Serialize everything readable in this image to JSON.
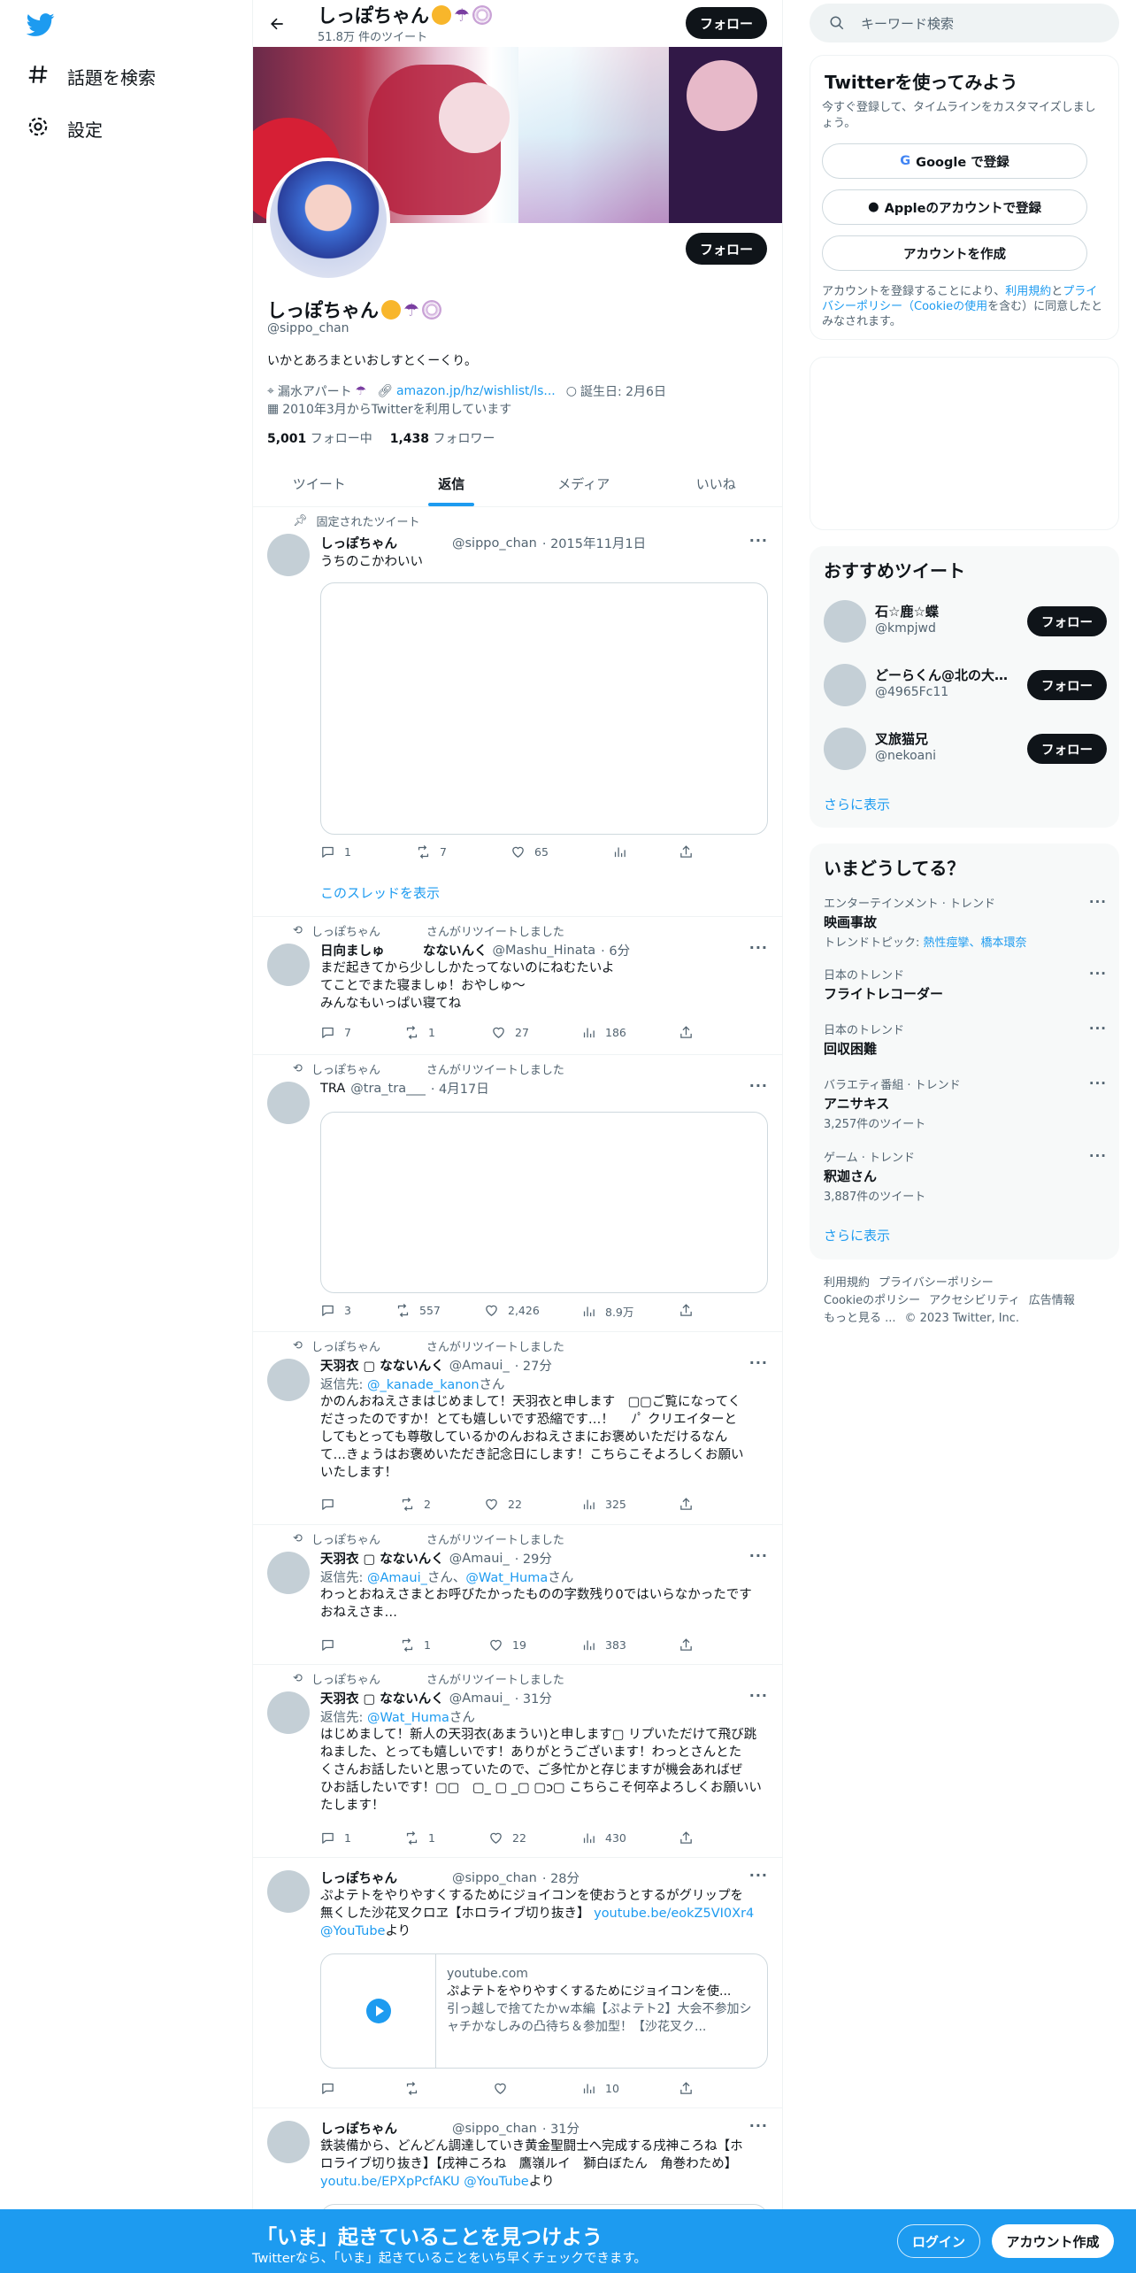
{
  "nav": {
    "explore_label": "話題を検索",
    "settings_label": "設定"
  },
  "header": {
    "name": "しっぽちゃん",
    "tweet_count": "51.8万 件のツイート",
    "follow_label": "フォロー"
  },
  "profile": {
    "name": "しっぽちゃん",
    "handle": "@sippo_chan",
    "bio": "いかとあろまといおしすとくーくり。",
    "location": "漏水アパート",
    "url": "amazon.jp/hz/wishlist/ls...",
    "birthday": "誕生日: 2月6日",
    "joined": "2010年3月からTwitterを利用しています",
    "following_count": "5,001",
    "following_label": "フォロー中",
    "followers_count": "1,438",
    "followers_label": "フォロワー",
    "follow_label": "フォロー"
  },
  "tabs": [
    {
      "label": "ツイート"
    },
    {
      "label": "返信"
    },
    {
      "label": "メディア"
    },
    {
      "label": "いいね"
    }
  ],
  "tweets": [
    {
      "social": "固定されたツイート",
      "name": "しっぽちゃん",
      "handle": "@sippo_chan",
      "time": "· 2015年11月1日",
      "text": "うちのこかわいい",
      "replies": "1",
      "retweets": "7",
      "likes": "65",
      "views": "",
      "thread_link": "このスレッドを表示"
    },
    {
      "social": "しっぽちゃん　　　　さんがリツイートしました",
      "name": "日向ましゅ　　　なないんく",
      "handle": "@Mashu_Hinata",
      "time": "· 6分",
      "text": "まだ起きてから少ししかたってないのにねむたいよ\nてことでまた寝ましゅ！おやしゅ～\nみんなもいっぱい寝てね",
      "replies": "7",
      "retweets": "1",
      "likes": "27",
      "views": "186"
    },
    {
      "social": "しっぽちゃん　　　　さんがリツイートしました",
      "name": "TRA",
      "handle": "@tra_tra___",
      "time": "· 4月17日",
      "text": "",
      "replies": "3",
      "retweets": "557",
      "likes": "2,426",
      "views": "8.9万"
    },
    {
      "social": "しっぽちゃん　　　　さんがリツイートしました",
      "name": "天羽衣 ▢ なないんく",
      "handle": "@Amaui_",
      "time": "· 27分",
      "reply_prefix": "返信先: ",
      "reply_to": "@_kanade_kanon",
      "reply_suffix": "さん",
      "text": "かのんおねえさまはじめまして！天羽衣と申します　▢▢ご覧になってく\nださったのですか！とても嬉しいです恐縮です…！　 ﾉﾟ クリエイターと\nしてもとっても尊敬しているかのんおねえさまにお褒めいただけるなん\nて…きょうはお褒めいただき記念日にします！こちらこそよろしくお願い\nいたします！",
      "replies": "",
      "retweets": "2",
      "likes": "22",
      "views": "325"
    },
    {
      "social": "しっぽちゃん　　　　さんがリツイートしました",
      "name": "天羽衣 ▢ なないんく",
      "handle": "@Amaui_",
      "time": "· 29分",
      "reply_prefix": "返信先: ",
      "reply_to": "@Amaui_",
      "reply_mid": "さん、",
      "reply_to2": "@Wat_Huma",
      "reply_suffix": "さん",
      "text": "わっとおねえさまとお呼びたかったものの字数残り0ではいらなかったです\nおねえさま…",
      "replies": "",
      "retweets": "1",
      "likes": "19",
      "views": "383"
    },
    {
      "social": "しっぽちゃん　　　　さんがリツイートしました",
      "name": "天羽衣 ▢ なないんく",
      "handle": "@Amaui_",
      "time": "· 31分",
      "reply_prefix": "返信先: ",
      "reply_to": "@Wat_Huma",
      "reply_suffix": "さん",
      "text": "はじめまして！新人の天羽衣(あまうい)と申します▢ リプいただけて飛び跳\nねました、とっても嬉しいです！ありがとうございます！わっとさんとた\nくさんお話したいと思っていたので、ご多忙かと存じますが機会あればぜ\nひお話したいです！▢▢　▢_ ▢ _▢ ▢ɔ▢ こちらこそ何卒よろしくお願いい\nたします！",
      "replies": "1",
      "retweets": "1",
      "likes": "22",
      "views": "430"
    },
    {
      "name": "しっぽちゃん",
      "handle": "@sippo_chan",
      "time": "· 28分",
      "text": "ぷよテトをやりやすくするためにジョイコンを使おうとするがグリップを\n無くした沙花叉クロヱ【ホロライブ切り抜き】 ",
      "link": "youtube.be/eokZ5VI0Xr4",
      "link2": "@YouTube",
      "suffix": "より",
      "card_domain": "youtube.com",
      "card_title": "ぷよテトをやりやすくするためにジョイコンを使...",
      "card_desc": "引っ越しで捨てたかｗ本編【ぷよテト2】大会不参加シャチかなしみの凸待ち＆参加型！【沙花叉ク...",
      "replies": "",
      "retweets": "",
      "likes": "",
      "views": "10"
    },
    {
      "name": "しっぽちゃん",
      "handle": "@sippo_chan",
      "time": "· 31分",
      "text": "鉄装備から、どんどん調達していき黄金聖闘士へ完成する戌神ころね【ホ\nロライブ切り抜き】【戌神ころね　鷹嶺ルイ　獅白ぼたん　角巻わため】",
      "link": "youtu.be/EPXpPcfAKU",
      "link2": "@YouTube",
      "suffix": "より"
    }
  ],
  "right": {
    "search_placeholder": "キーワード検索",
    "signup": {
      "title": "Twitterを使ってみよう",
      "desc": "今すぐ登録して、タイムラインをカスタマイズしましょう。",
      "google": "Google で登録",
      "apple": "Appleのアカウントで登録",
      "create": "アカウントを作成",
      "legal_pre": "アカウントを登録することにより、",
      "legal_terms": "利用規約",
      "legal_and": "と",
      "legal_privacy": "プライバシーポリシー（Cookieの使用",
      "legal_post": "を含む）に同意したとみなされます。"
    },
    "who": {
      "title": "おすすめツイート",
      "users": [
        {
          "name": "石☆鹿☆蝶",
          "handle": "@kmpjwd",
          "follow": "フォロー"
        },
        {
          "name": "どーらくん@北の大地より",
          "handle": "@4965Fc11",
          "follow": "フォロー"
        },
        {
          "name": "叉旅猫兄",
          "handle": "@nekoani",
          "follow": "フォロー"
        }
      ],
      "more": "さらに表示"
    },
    "trends": {
      "title": "いまどうしてる？",
      "items": [
        {
          "context": "エンターテインメント · トレンド",
          "topic": "映画事故",
          "extra_prefix": "トレンドトピック: ",
          "extra_links": "熱性痙攣、橋本環奈"
        },
        {
          "context": "日本のトレンド",
          "topic": "フライトレコーダー"
        },
        {
          "context": "日本のトレンド",
          "topic": "回収困難"
        },
        {
          "context": "バラエティ番組 · トレンド",
          "topic": "アニサキス",
          "count": "3,257件のツイート"
        },
        {
          "context": "ゲーム · トレンド",
          "topic": "釈迦さん",
          "count": "3,887件のツイート"
        }
      ],
      "more": "さらに表示"
    },
    "footer": {
      "l1a": "利用規約",
      "l1b": "プライバシーポリシー",
      "l2a": "Cookieのポリシー",
      "l2b": "アクセシビリティ",
      "l2c": "広告情報",
      "l3a": "もっと見る ...",
      "l3b": "© 2023 Twitter, Inc."
    }
  },
  "bottom": {
    "title": "「いま」起きていることを見つけよう",
    "sub": "Twitterなら、「いま」起きていることをいち早くチェックできます。",
    "login": "ログイン",
    "signup": "アカウント作成"
  },
  "colors": {
    "accent": "#1d9bf0",
    "text": "#0f1419",
    "muted": "#536471"
  }
}
